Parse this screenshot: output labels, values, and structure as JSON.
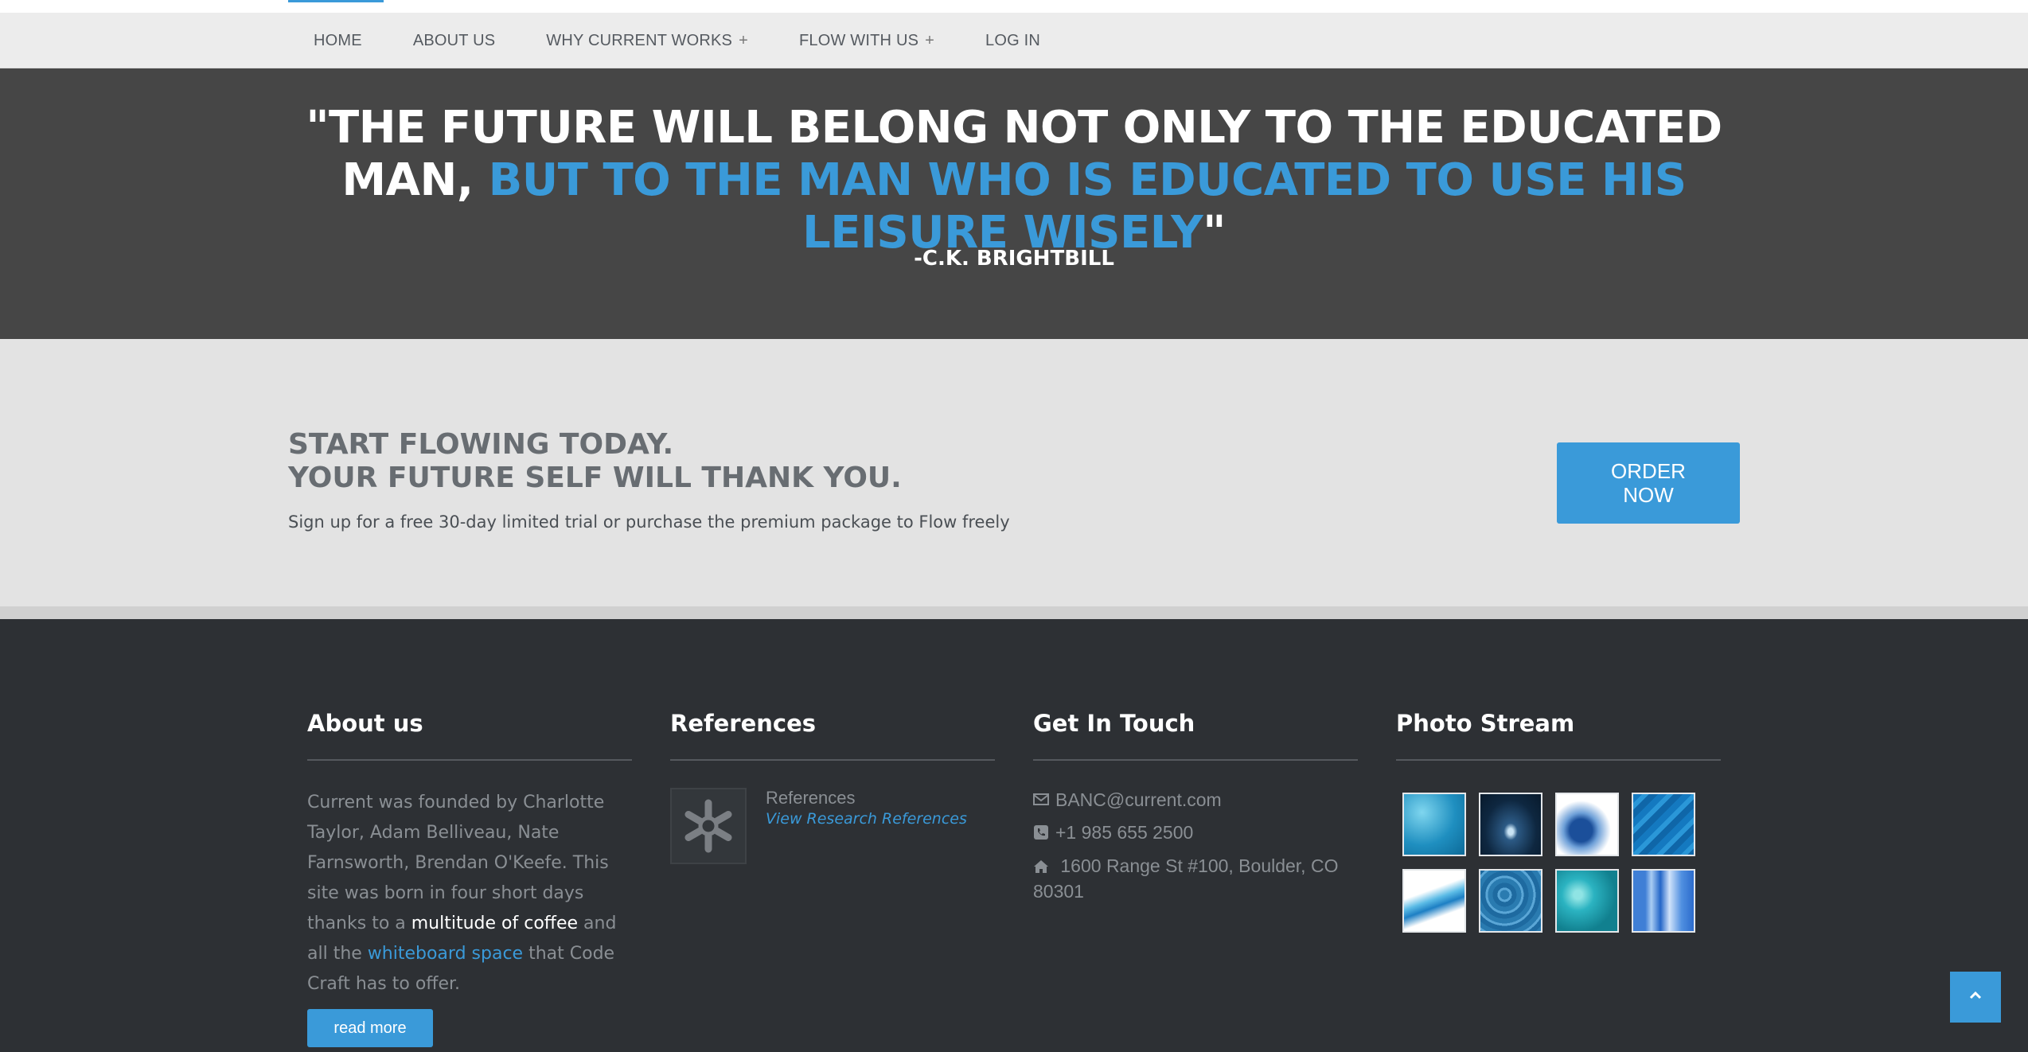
{
  "nav": {
    "items": [
      {
        "label": "HOME",
        "has_submenu": false
      },
      {
        "label": "ABOUT US",
        "has_submenu": false
      },
      {
        "label": "WHY CURRENT WORKS",
        "has_submenu": true
      },
      {
        "label": "FLOW WITH US",
        "has_submenu": true
      },
      {
        "label": "LOG IN",
        "has_submenu": false
      }
    ],
    "submenu_marker": "+"
  },
  "quote": {
    "open": "\"THE FUTURE WILL BELONG NOT ONLY TO THE EDUCATED MAN, ",
    "highlight": "BUT TO THE MAN WHO IS EDUCATED TO USE HIS LEISURE WISELY",
    "close": "\"",
    "author": "-C.K. BRIGHTBILL"
  },
  "cta": {
    "title_line1": "START FLOWING TODAY.",
    "title_line2": "YOUR FUTURE SELF WILL THANK YOU.",
    "subtitle": "Sign up for a free 30-day limited trial or purchase the premium package to Flow freely",
    "button_line1": "ORDER",
    "button_line2": "NOW"
  },
  "footer": {
    "about": {
      "heading": "About us",
      "text_part1": "Current was founded by Charlotte Taylor, Adam Belliveau, Nate Farnsworth, Brendan O'Keefe. This site was born in four short days thanks to a ",
      "text_highlight1": "multitude of coffee",
      "text_part2": " and all the ",
      "text_highlight2": "whiteboard space",
      "text_part3": " that Code Craft has to offer.",
      "read_more": "read more"
    },
    "references": {
      "heading": "References",
      "item_title": "References",
      "item_link": "View Research References"
    },
    "contact": {
      "heading": "Get In Touch",
      "email": "BANC@current.com",
      "phone": "+1 985 655 2500",
      "address": "1600 Range St #100, Boulder, CO 80301"
    },
    "photos": {
      "heading": "Photo Stream",
      "items": [
        {
          "name": "water-surface-photo"
        },
        {
          "name": "water-drop-photo"
        },
        {
          "name": "water-splash-photo"
        },
        {
          "name": "water-ripple-photo"
        },
        {
          "name": "water-wave-photo"
        },
        {
          "name": "pool-water-photo"
        },
        {
          "name": "bubbles-photo"
        },
        {
          "name": "water-glass-photo"
        }
      ]
    }
  },
  "colors": {
    "accent": "#3a9ad9",
    "nav_bg": "#ececec",
    "quote_bg": "#464646",
    "cta_bg": "#e3e3e3",
    "footer_bg": "#2d3034"
  }
}
